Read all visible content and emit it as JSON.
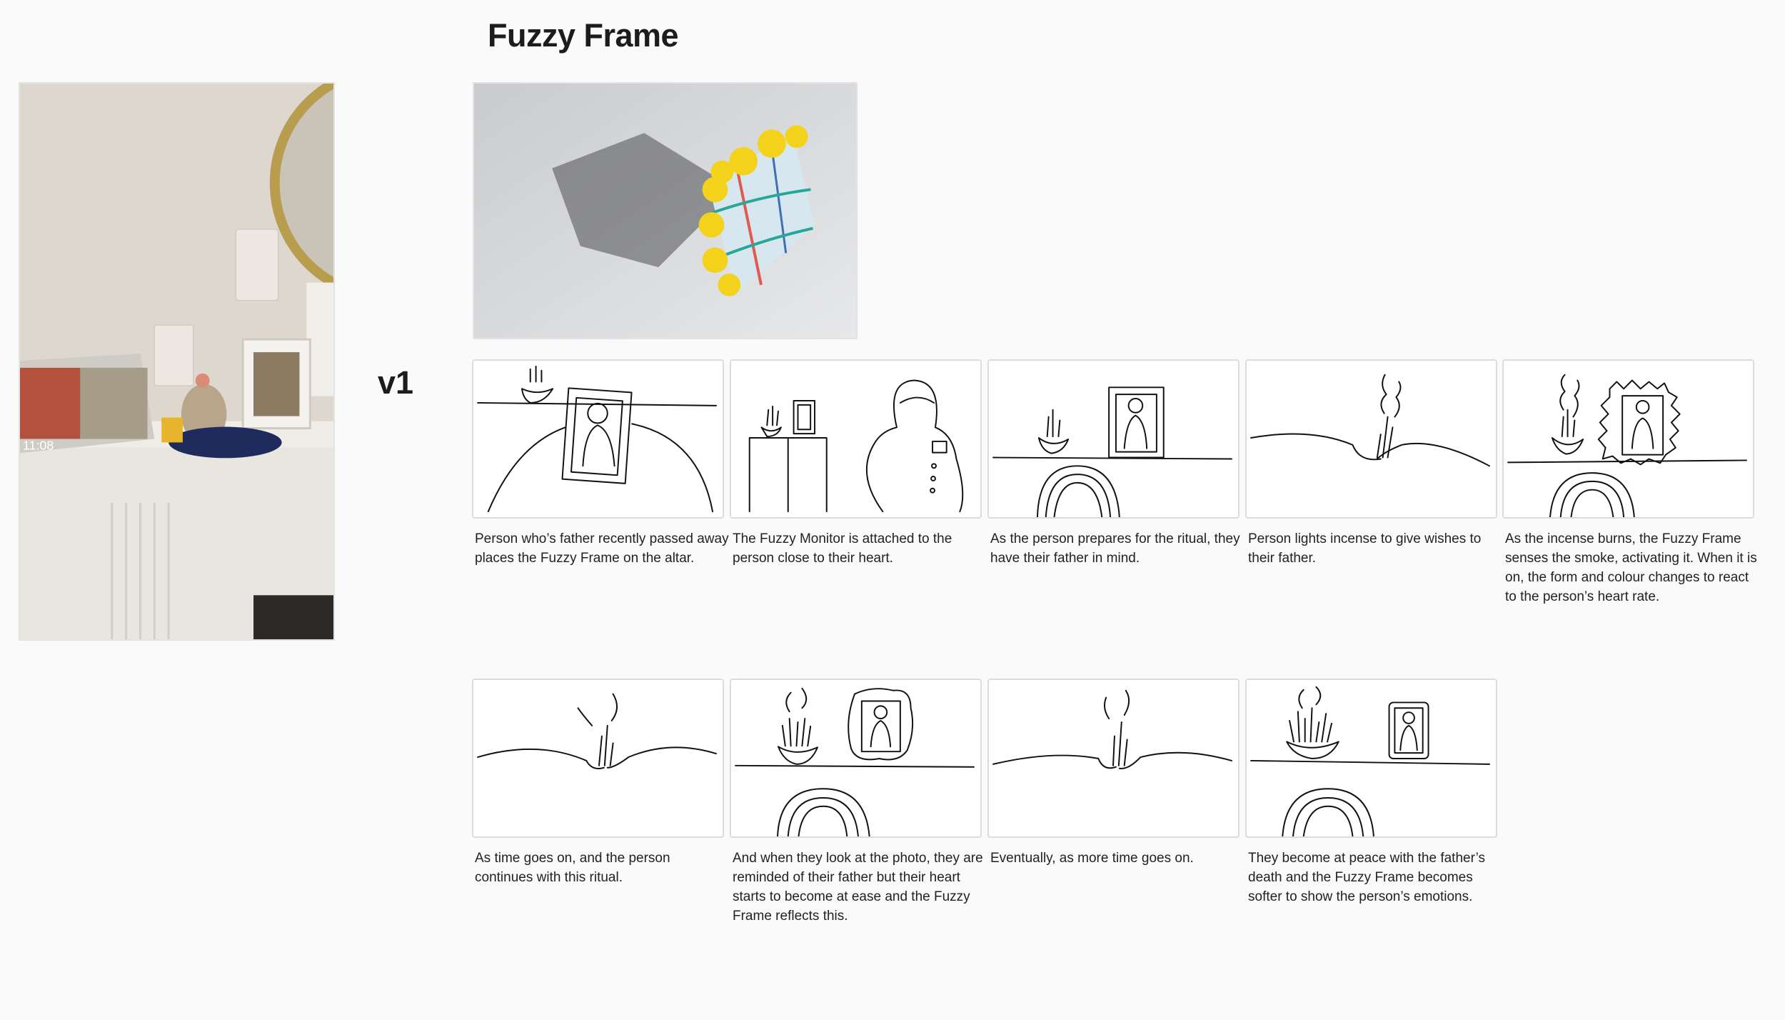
{
  "page": {
    "title": "Fuzzy Frame",
    "version_label": "v1"
  },
  "photos": {
    "altar_clock": "11:08"
  },
  "storyboard": {
    "row1": [
      {
        "caption": "Person who’s father recently passed away places the Fuzzy Frame on the altar."
      },
      {
        "caption": "The Fuzzy Monitor is attached to the person close to their heart."
      },
      {
        "caption": "As the person prepares for the ritual, they have their father in mind."
      },
      {
        "caption": "Person lights incense to give wishes to their father."
      },
      {
        "caption": "As the incense burns, the Fuzzy Frame senses the smoke, activating it. When it is on, the form and colour changes to react to the person’s heart rate."
      }
    ],
    "row2": [
      {
        "caption": "As time goes on, and the person continues with this ritual."
      },
      {
        "caption": "And when they look at the photo, they are reminded of their father but their heart starts to become at ease and the Fuzzy Frame reflects this."
      },
      {
        "caption": "Eventually, as more time goes on."
      },
      {
        "caption": "They become at peace with the father’s death and the Fuzzy Frame becomes softer to show the person’s emotions."
      }
    ]
  },
  "colors": {
    "background": "#fafafa",
    "fuzzy_yellow": "#f2d21b",
    "wall_beige": "#d8d2c8",
    "ink": "#111111"
  }
}
